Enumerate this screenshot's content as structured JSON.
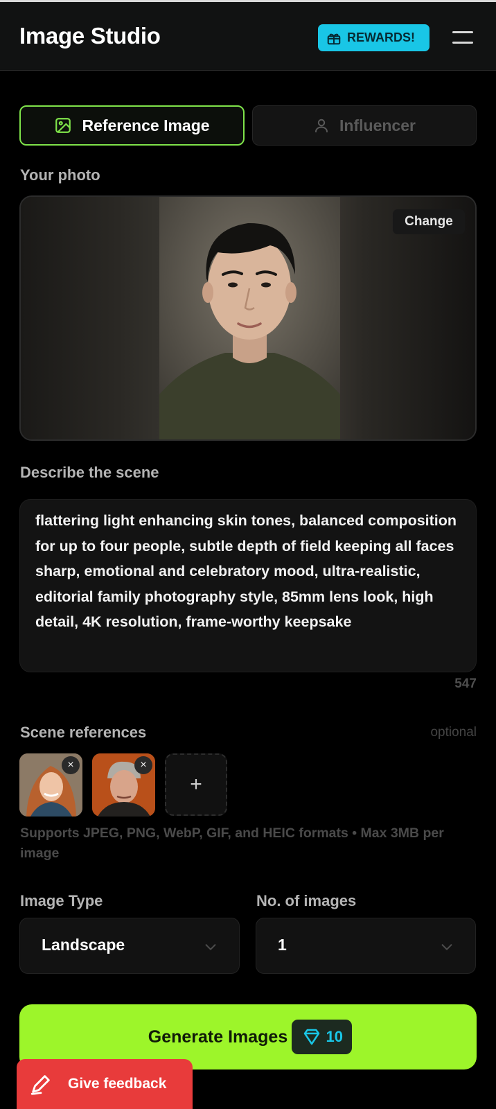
{
  "header": {
    "title": "Image Studio",
    "rewards_label": "REWARDS!"
  },
  "tabs": [
    {
      "label": "Reference Image",
      "active": true
    },
    {
      "label": "Influencer",
      "active": false
    }
  ],
  "photo": {
    "label": "Your photo",
    "change_label": "Change"
  },
  "scene": {
    "label": "Describe the scene",
    "text": "flattering light enhancing skin tones, balanced composition for up to four people, subtle depth of field keeping all faces sharp, emotional and celebratory mood, ultra-realistic, editorial family photography style, 85mm lens look, high detail, 4K resolution, frame-worthy keepsake",
    "char_count": "547"
  },
  "scene_references": {
    "label": "Scene references",
    "optional_label": "optional",
    "formats_note": "Supports JPEG, PNG, WebP, GIF, and HEIC formats • Max 3MB per image",
    "add_label": "+",
    "remove_label": "×"
  },
  "image_type": {
    "label": "Image Type",
    "value": "Landscape"
  },
  "num_images": {
    "label": "No. of images",
    "value": "1"
  },
  "generate": {
    "label": "Generate Images",
    "cost": "10"
  },
  "feedback": {
    "label": "Give feedback"
  },
  "colors": {
    "accent_green": "#9df52a",
    "accent_cyan": "#19c6e6",
    "feedback_red": "#e83b3b",
    "background": "#000000"
  },
  "icons": [
    "gift-icon",
    "menu-icon",
    "image-icon",
    "user-icon",
    "chevron-down-icon",
    "gem-icon",
    "pencil-icon",
    "close-icon",
    "plus-icon"
  ]
}
